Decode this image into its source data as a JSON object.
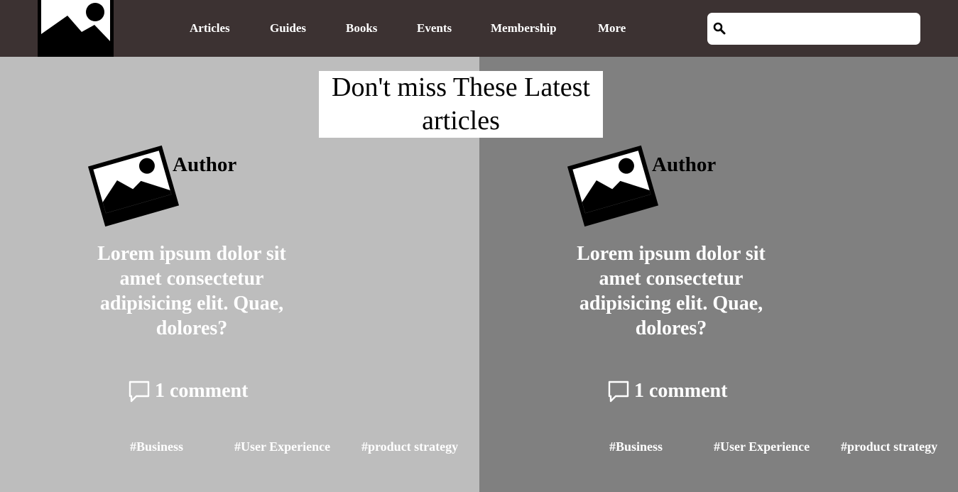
{
  "nav": {
    "logo_icon": "image-placeholder-icon",
    "links": [
      "Articles",
      "Guides",
      "Books",
      "Events",
      "Membership",
      "More"
    ],
    "search": {
      "icon": "search-icon",
      "placeholder": "",
      "value": ""
    }
  },
  "headline": {
    "line1": "Don't miss These Latest",
    "line2": "articles"
  },
  "cards": [
    {
      "author": "Author",
      "author_icon": "image-placeholder-icon",
      "text": "Lorem ipsum dolor sit amet consectetur adipisicing elit. Quae, dolores?",
      "comments": "1 comment",
      "comment_icon": "comment-icon",
      "tags": [
        "#Business",
        "#User Experience",
        "#product strategy"
      ]
    },
    {
      "author": "Author",
      "author_icon": "image-placeholder-icon",
      "text": "Lorem ipsum dolor sit amet consectetur adipisicing elit. Quae, dolores?",
      "comments": "1 comment",
      "comment_icon": "comment-icon",
      "tags": [
        "#Business",
        "#User Experience",
        "#product strategy"
      ]
    }
  ],
  "colors": {
    "navbar": "#3c3232",
    "left_panel": "#bdbdbd",
    "right_panel": "#808080",
    "text_light": "#ffffff"
  }
}
